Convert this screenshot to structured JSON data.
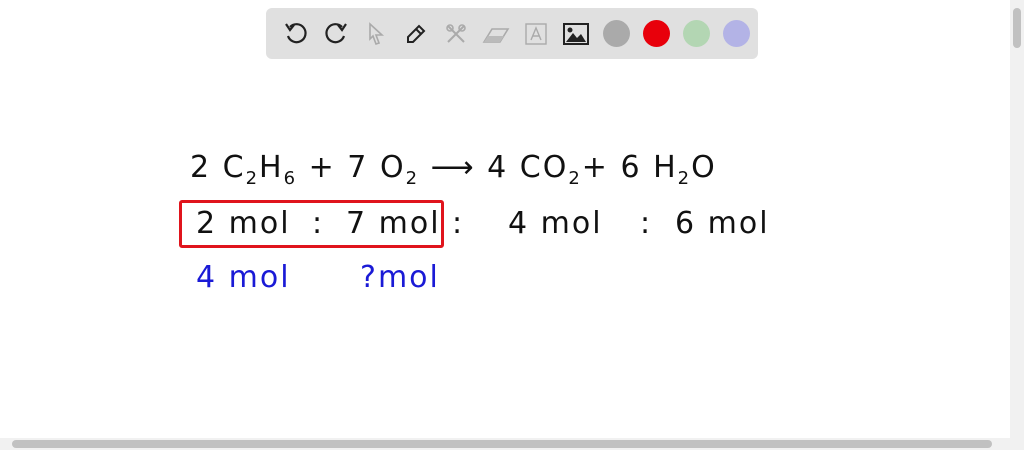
{
  "toolbar": {
    "tools": [
      "undo",
      "redo",
      "select",
      "pen",
      "tools",
      "eraser",
      "text",
      "image"
    ],
    "colors": [
      "#aaaaaa",
      "#e8000b",
      "#b3d6b3",
      "#b3b3e6"
    ]
  },
  "equation": {
    "c1": "2",
    "r1": "C",
    "r1s": "2",
    "r1b": "H",
    "r1bs": "6",
    "plus1": "+",
    "c2": "7",
    "r2": "O",
    "r2s": "2",
    "arrow": "⟶",
    "c3": "4",
    "p1": "CO",
    "p1s": "2",
    "plus2": "+",
    "c4": "6",
    "p2": "H",
    "p2s": "2",
    "p2b": "O"
  },
  "ratios": {
    "a": "2 mol",
    "sep1": ":",
    "b": "7 mol",
    "sep2": ":",
    "c": "4 mol",
    "sep3": ":",
    "d": "6 mol"
  },
  "given": {
    "a": "4 mol",
    "b": "?",
    "b_unit": "mol"
  }
}
